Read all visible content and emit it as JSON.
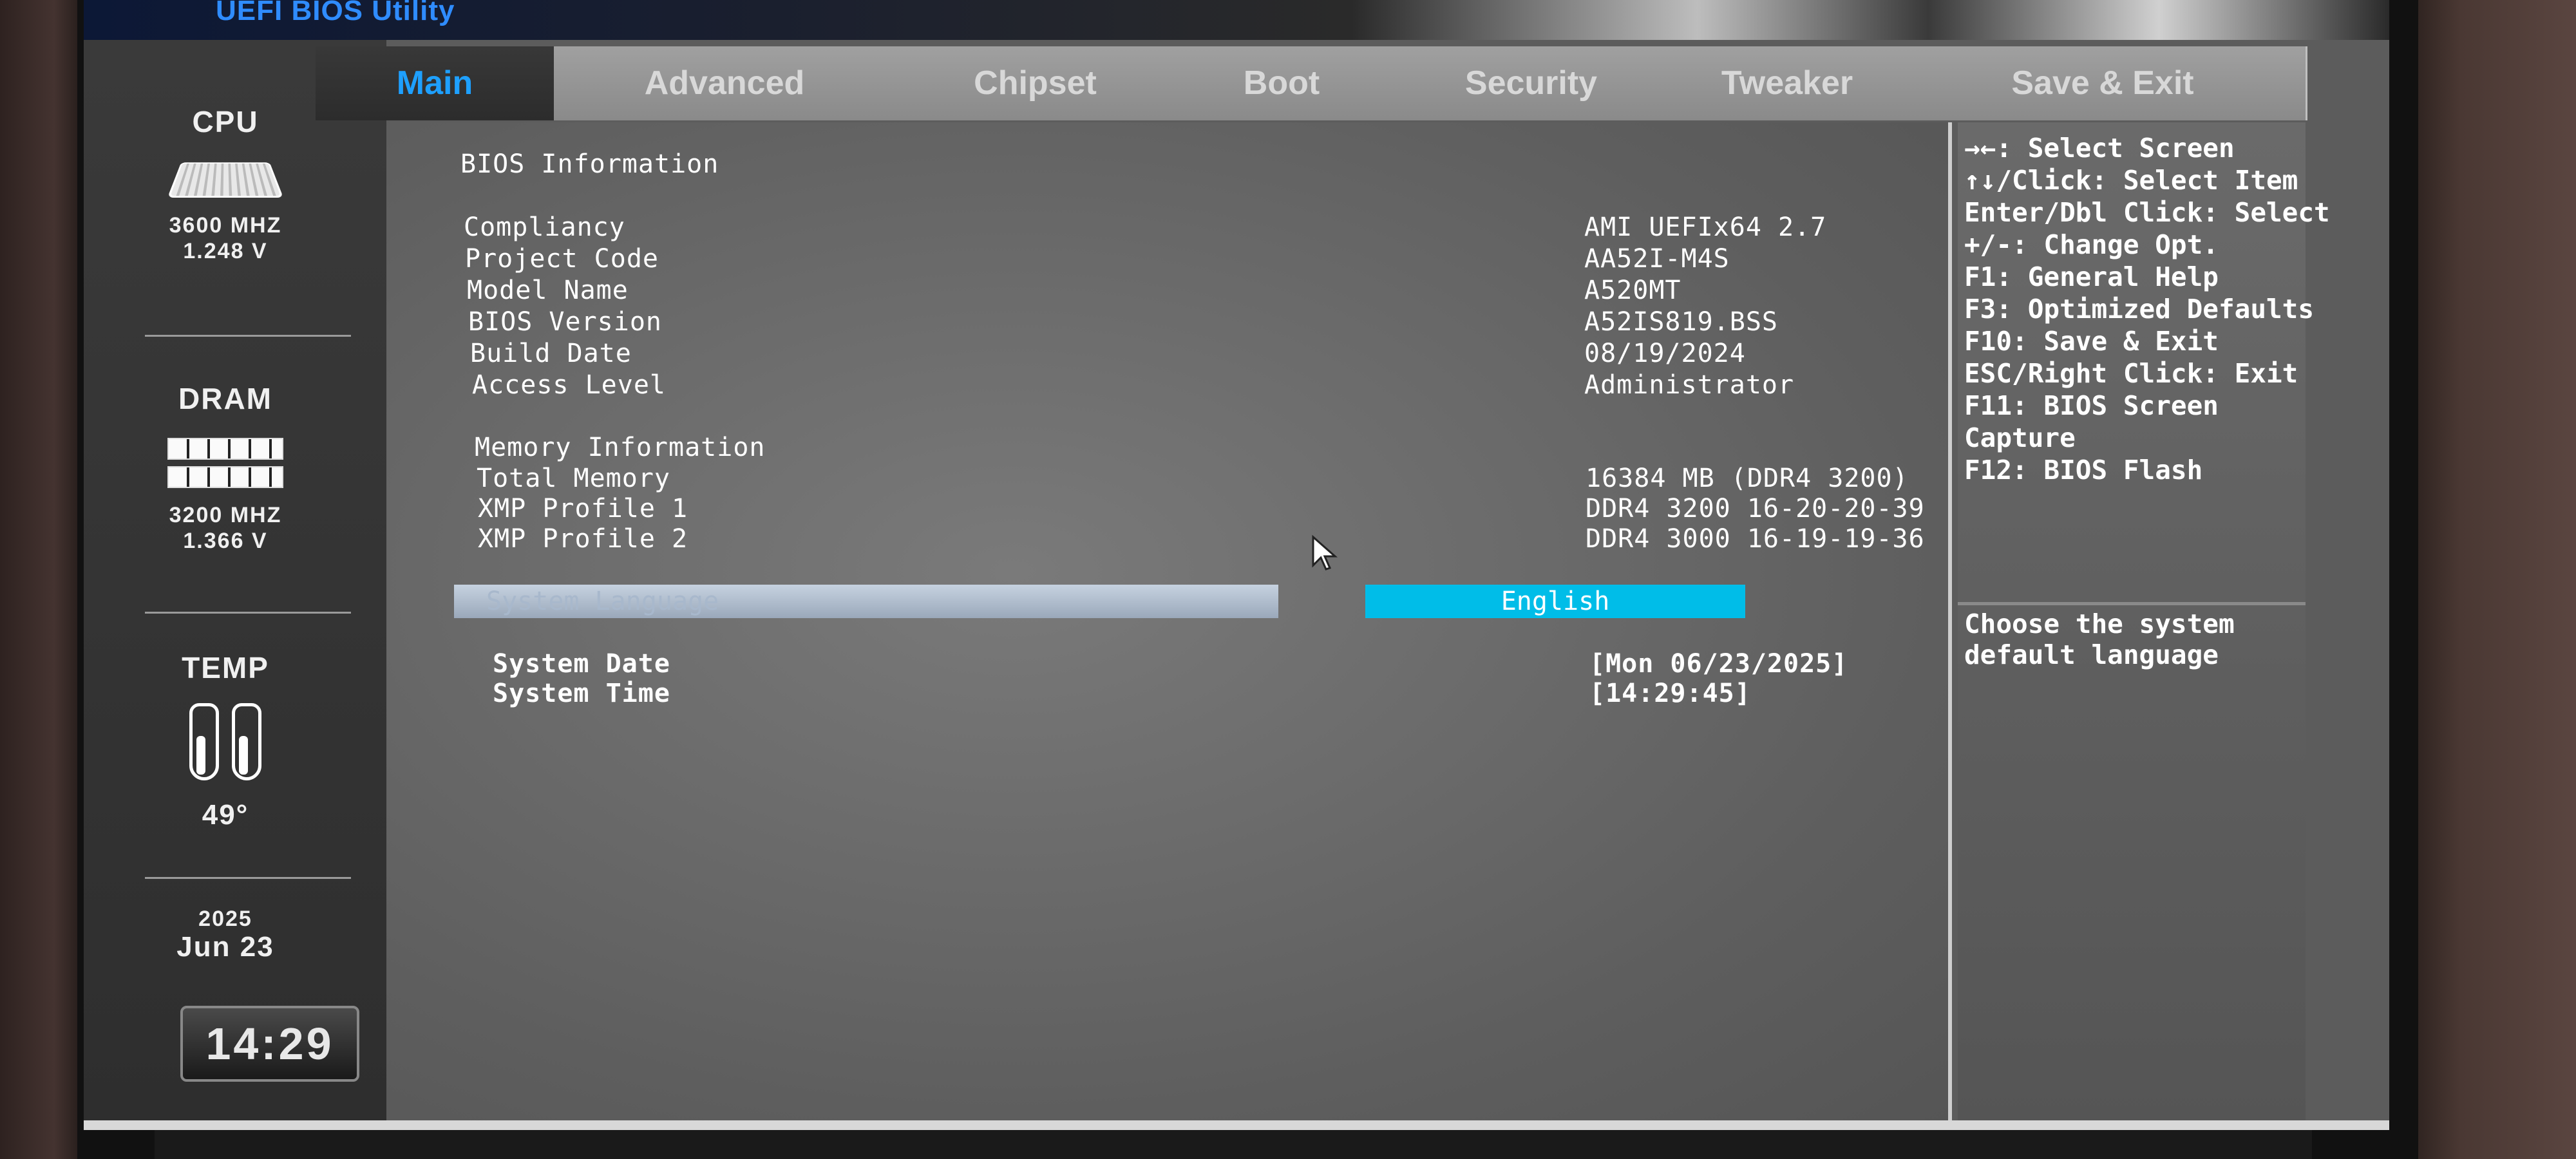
{
  "app": {
    "title": "UEFI BIOS Utility"
  },
  "status": {
    "cpu": {
      "title": "CPU",
      "freq": "3600 MHZ",
      "volt": "1.248 V"
    },
    "dram": {
      "title": "DRAM",
      "freq": "3200 MHZ",
      "volt": "1.366 V"
    },
    "temp": {
      "title": "TEMP",
      "value": "49°"
    },
    "date": {
      "year": "2025",
      "day": "Jun 23"
    },
    "clock": "14:29"
  },
  "tabs": [
    "Main",
    "Advanced",
    "Chipset",
    "Boot",
    "Security",
    "Tweaker",
    "Save & Exit"
  ],
  "active_tab": "Main",
  "main": {
    "bios_header": "BIOS Information",
    "bios_info": [
      {
        "label": "Compliancy",
        "value": "AMI UEFIx64 2.7"
      },
      {
        "label": "Project Code",
        "value": "AA52I-M4S"
      },
      {
        "label": "Model Name",
        "value": "A520MT"
      },
      {
        "label": "BIOS Version",
        "value": "A52IS819.BSS"
      },
      {
        "label": "Build Date",
        "value": "08/19/2024"
      },
      {
        "label": "Access Level",
        "value": "Administrator"
      }
    ],
    "memory_header": "Memory Information",
    "memory_info": [
      {
        "label": "Total Memory",
        "value": "16384 MB (DDR4 3200)"
      },
      {
        "label": "XMP Profile 1",
        "value": "DDR4 3200 16-20-20-39"
      },
      {
        "label": "XMP Profile 2",
        "value": "DDR4 3000 16-19-19-36"
      }
    ],
    "language": {
      "label": "System Language",
      "value": "English"
    },
    "system_date": {
      "label": "System Date",
      "value": "[Mon 06/23/2025]"
    },
    "system_time": {
      "label": "System Time",
      "value": "[14:29:45]"
    }
  },
  "help": {
    "keys": [
      "→←: Select Screen",
      "↑↓/Click: Select Item",
      "Enter/Dbl Click: Select",
      "+/-: Change Opt.",
      "F1: General Help",
      "F3: Optimized Defaults",
      "F10: Save & Exit",
      "ESC/Right Click: Exit",
      "F11: BIOS Screen",
      "Capture",
      "F12: BIOS Flash"
    ],
    "description": "Choose the system default language"
  },
  "colors": {
    "active_tab_text": "#1ea0ff",
    "selected_value_bg": "#00bde8",
    "title_blue": "#2f8cff"
  }
}
